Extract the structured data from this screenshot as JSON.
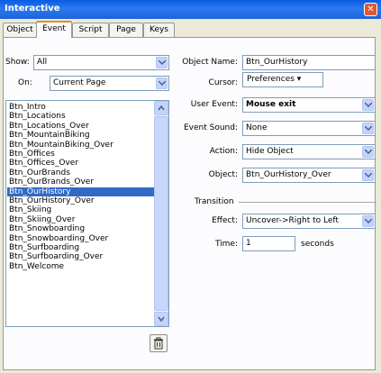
{
  "window": {
    "title": "Interactive"
  },
  "tabs": [
    "Object",
    "Event",
    "Script",
    "Page",
    "Keys"
  ],
  "left": {
    "show_label": "Show:",
    "show_value": "All",
    "on_label": "On:",
    "on_value": "Current Page",
    "list_items": [
      "Btn_Intro",
      "Btn_Locations",
      "Btn_Locations_Over",
      "Btn_MountainBiking",
      "Btn_MountainBiking_Over",
      "Btn_Offices",
      "Btn_Offices_Over",
      "Btn_OurBrands",
      "Btn_OurBrands_Over",
      "Btn_OurHistory",
      "Btn_OurHistory_Over",
      "Btn_Skiing",
      "Btn_Skiing_Over",
      "Btn_Snowboarding",
      "Btn_Snowboarding_Over",
      "Btn_Surfboarding",
      "Btn_Surfboarding_Over",
      "Btn_Welcome"
    ],
    "selected_item": "Btn_OurHistory"
  },
  "right": {
    "object_name_label": "Object Name:",
    "object_name_value": "Btn_OurHistory",
    "cursor_label": "Cursor:",
    "cursor_value": "Preferences ▾",
    "user_event_label": "User Event:",
    "user_event_value": "Mouse exit",
    "event_sound_label": "Event Sound:",
    "event_sound_value": "None",
    "action_label": "Action:",
    "action_value": "Hide Object",
    "object_label": "Object:",
    "object_value": "Btn_OurHistory_Over",
    "transition_label": "Transition",
    "effect_label": "Effect:",
    "effect_value": "Uncover->Right to Left",
    "time_label": "Time:",
    "time_value": "1",
    "time_unit": "seconds"
  },
  "icons": {
    "close": "close-icon",
    "trash": "trash-icon",
    "dropdown": "chevron-down-icon"
  },
  "colors": {
    "titlebar": "#0a5ce0",
    "selection": "#316ac5",
    "active_tab": "#e68b2c"
  }
}
